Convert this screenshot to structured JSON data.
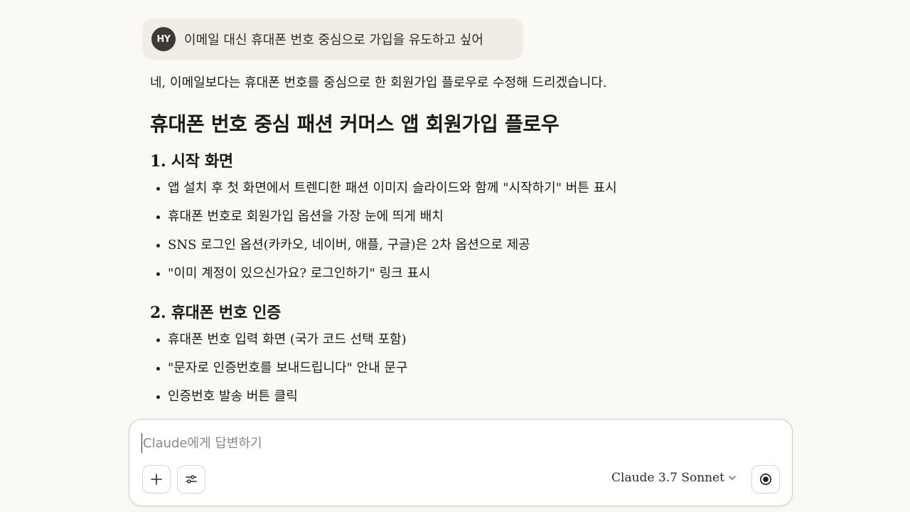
{
  "user_message": {
    "avatar_initials": "HY",
    "text": "이메일 대신 휴대폰 번호 중심으로 가입을 유도하고 싶어"
  },
  "response": {
    "intro": "네, 이메일보다는 휴대폰 번호를 중심으로 한 회원가입 플로우로 수정해 드리겠습니다.",
    "title": "휴대폰 번호 중심 패션 커머스 앱 회원가입 플로우",
    "sections": [
      {
        "heading": "1. 시작 화면",
        "bullets": [
          "앱 설치 후 첫 화면에서 트렌디한 패션 이미지 슬라이드와 함께 \"시작하기\" 버튼 표시",
          "휴대폰 번호로 회원가입 옵션을 가장 눈에 띄게 배치",
          "SNS 로그인 옵션(카카오, 네이버, 애플, 구글)은 2차 옵션으로 제공",
          "\"이미 계정이 있으신가요? 로그인하기\" 링크 표시"
        ]
      },
      {
        "heading": "2. 휴대폰 번호 인증",
        "bullets": [
          "휴대폰 번호 입력 화면 (국가 코드 선택 포함)",
          "\"문자로 인증번호를 보내드립니다\" 안내 문구",
          "인증번호 발송 버튼 클릭"
        ]
      }
    ]
  },
  "composer": {
    "placeholder": "Claude에게 답변하기",
    "value": "",
    "model_label": "Claude 3.7 Sonnet",
    "icons": {
      "attach": "plus-icon",
      "tools": "sliders-icon",
      "model_dropdown": "chevron-down-icon",
      "record": "record-icon"
    }
  },
  "colors": {
    "background": "#faf9f5",
    "user_bubble": "#efede4",
    "avatar": "#3b3a36",
    "text": "#1a1915"
  }
}
